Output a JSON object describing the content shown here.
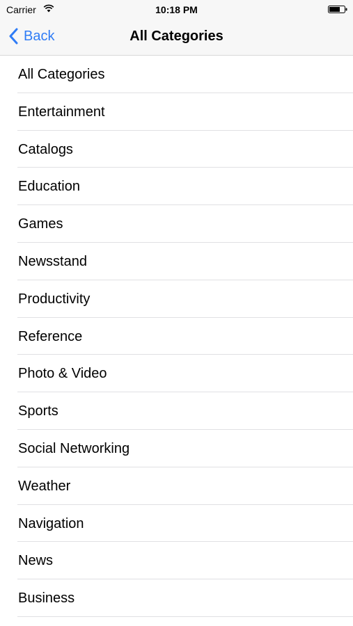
{
  "status_bar": {
    "carrier": "Carrier",
    "time": "10:18 PM",
    "wifi_icon": "wifi-icon",
    "battery_icon": "battery-icon"
  },
  "nav_bar": {
    "back_label": "Back",
    "back_icon": "chevron-left-icon",
    "title": "All Categories",
    "accent_color": "#2f7cf6"
  },
  "categories": [
    {
      "label": "All Categories"
    },
    {
      "label": "Entertainment"
    },
    {
      "label": "Catalogs"
    },
    {
      "label": "Education"
    },
    {
      "label": "Games"
    },
    {
      "label": "Newsstand"
    },
    {
      "label": "Productivity"
    },
    {
      "label": "Reference"
    },
    {
      "label": "Photo & Video"
    },
    {
      "label": "Sports"
    },
    {
      "label": "Social Networking"
    },
    {
      "label": "Weather"
    },
    {
      "label": "Navigation"
    },
    {
      "label": "News"
    },
    {
      "label": "Business"
    }
  ]
}
